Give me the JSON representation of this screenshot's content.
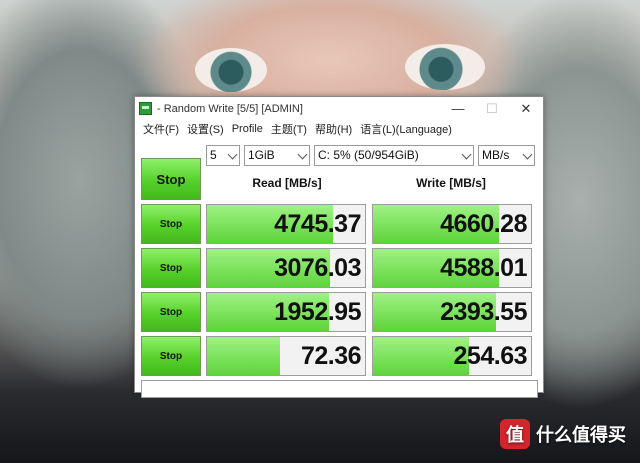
{
  "window": {
    "title": "- Random Write [5/5] [ADMIN]",
    "controls": {
      "minimize": "—",
      "maximize": "☐",
      "close": "✕"
    }
  },
  "menu": [
    "文件(F)",
    "设置(S)",
    "Profile",
    "主题(T)",
    "帮助(H)",
    "语言(L)(Language)"
  ],
  "toolbar": {
    "main_button": "Stop",
    "count": "5",
    "size": "1GiB",
    "drive": "C: 5% (50/954GiB)",
    "unit": "MB/s"
  },
  "headers": {
    "read": "Read [MB/s]",
    "write": "Write [MB/s]"
  },
  "rows": [
    {
      "button": "Stop",
      "read": "4745.37",
      "write": "4660.28",
      "read_fill": 0.8,
      "write_fill": 0.8
    },
    {
      "button": "Stop",
      "read": "3076.03",
      "write": "4588.01",
      "read_fill": 0.78,
      "write_fill": 0.8
    },
    {
      "button": "Stop",
      "read": "1952.95",
      "write": "2393.55",
      "read_fill": 0.77,
      "write_fill": 0.78
    },
    {
      "button": "Stop",
      "read": "72.36",
      "write": "254.63",
      "read_fill": 0.46,
      "write_fill": 0.61
    }
  ],
  "comment": "",
  "watermark": {
    "badge": "值",
    "text": "什么值得买"
  },
  "colors": {
    "accent_green": "#56d12a",
    "bar_green": "#5ed43a"
  }
}
